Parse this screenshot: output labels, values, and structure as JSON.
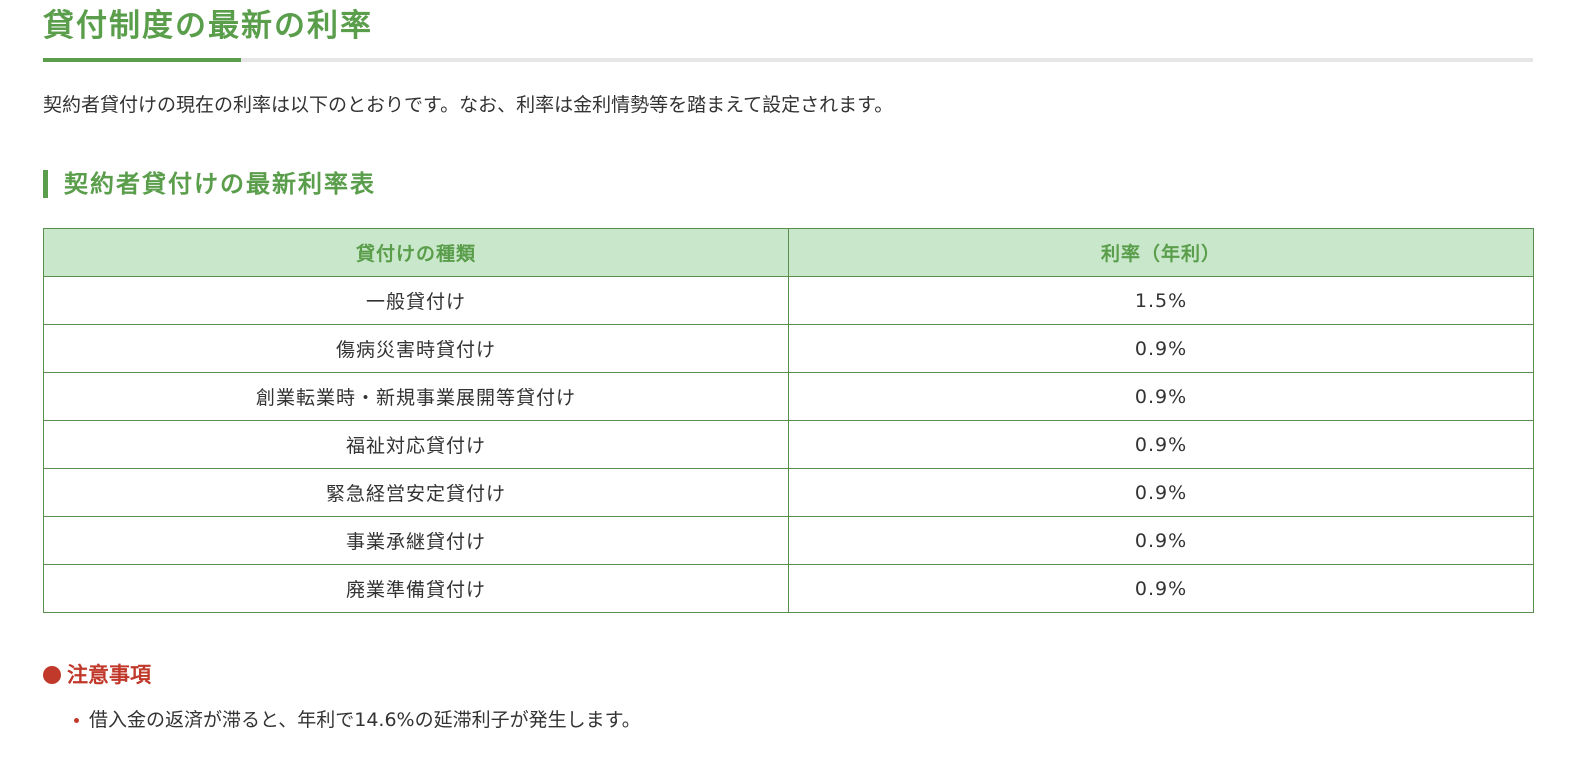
{
  "header": {
    "title": "貸付制度の最新の利率"
  },
  "intro": {
    "text": "契約者貸付けの現在の利率は以下のとおりです。なお、利率は金利情勢等を踏まえて設定されます。"
  },
  "section": {
    "heading": "契約者貸付けの最新利率表"
  },
  "rate_table": {
    "columns": [
      "貸付けの種類",
      "利率（年利）"
    ],
    "rows": [
      {
        "type": "一般貸付け",
        "rate": "1.5%"
      },
      {
        "type": "傷病災害時貸付け",
        "rate": "0.9%"
      },
      {
        "type": "創業転業時・新規事業展開等貸付け",
        "rate": "0.9%"
      },
      {
        "type": "福祉対応貸付け",
        "rate": "0.9%"
      },
      {
        "type": "緊急経営安定貸付け",
        "rate": "0.9%"
      },
      {
        "type": "事業承継貸付け",
        "rate": "0.9%"
      },
      {
        "type": "廃業準備貸付け",
        "rate": "0.9%"
      }
    ]
  },
  "notes": {
    "heading": "注意事項",
    "items": [
      "借入金の返済が滞ると、年利で14.6%の延滞利子が発生します。"
    ]
  },
  "colors": {
    "accent_green": "#5a9e4c",
    "header_bg": "#c9e7ca",
    "table_border": "#5a8e4e",
    "notice_red": "#c0392b",
    "text": "#333333"
  }
}
